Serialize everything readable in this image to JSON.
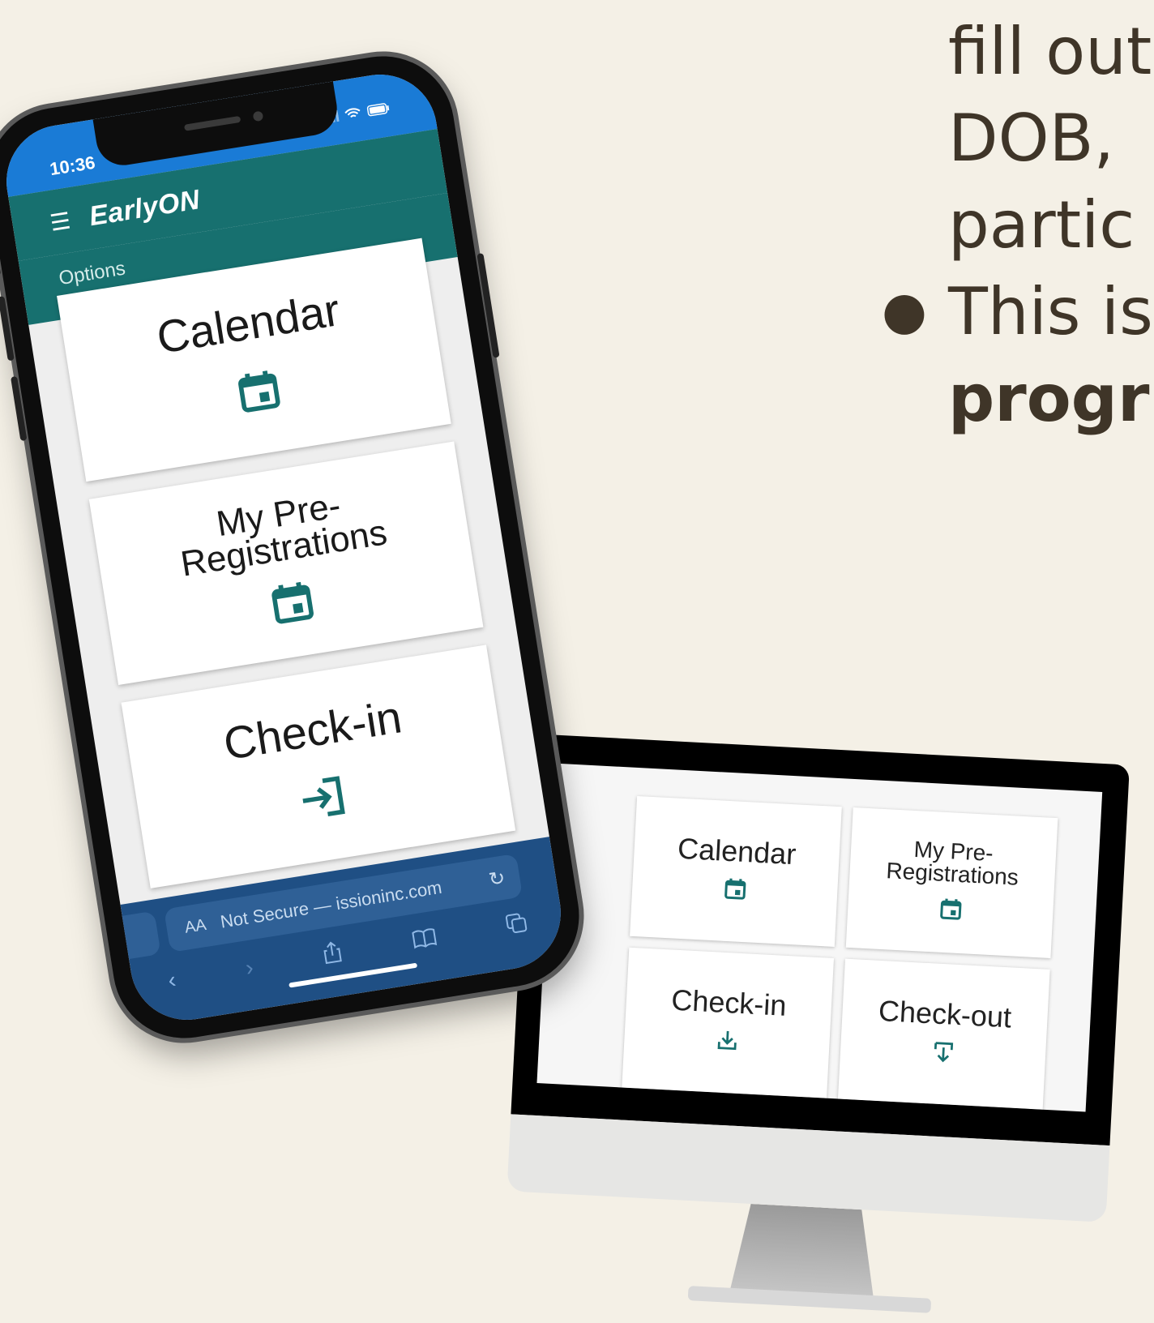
{
  "background_text": {
    "line1": "fill out",
    "line2": "DOB,",
    "line3": "partic",
    "line4": "This is",
    "line5": "progr"
  },
  "phone": {
    "status_time": "10:36",
    "brand": "EarlyON",
    "options_label": "Options",
    "tiles": [
      {
        "label": "Calendar",
        "icon": "calendar-icon"
      },
      {
        "label": "My Pre-Registrations",
        "icon": "calendar-icon"
      },
      {
        "label": "Check-in",
        "icon": "login-arrow-icon"
      }
    ],
    "browser": {
      "aa": "AA",
      "url": "Not Secure — issioninc.com"
    }
  },
  "monitor": {
    "tiles": [
      {
        "label": "Calendar",
        "icon": "calendar-icon"
      },
      {
        "label": "My Pre-Registrations",
        "icon": "calendar-icon"
      },
      {
        "label": "Check-in",
        "icon": "download-tray-icon"
      },
      {
        "label": "Check-out",
        "icon": "upload-tray-icon"
      }
    ]
  },
  "colors": {
    "background": "#f4f0e6",
    "teal": "#17706f",
    "status_blue": "#1a7bd6",
    "browser_blue": "#1f4f84",
    "text_dark": "#3f3528"
  }
}
